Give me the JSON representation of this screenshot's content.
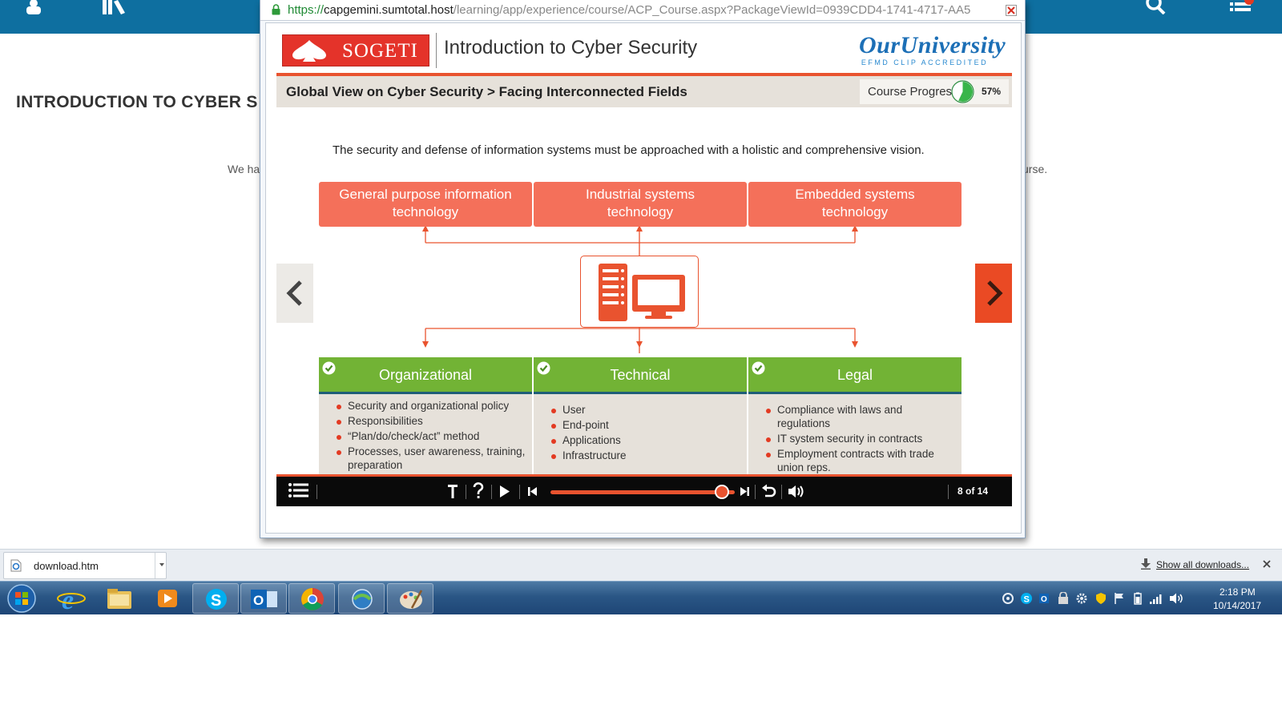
{
  "page": {
    "heading": "INTRODUCTION TO CYBER S",
    "text_left": "We ha",
    "text_right": "urse."
  },
  "browser": {
    "url_scheme": "https://",
    "url_host": "capgemini.sumtotal.host",
    "url_path": "/learning/app/experience/course/ACP_Course.aspx?PackageViewId=0939CDD4-1741-4717-AA5"
  },
  "course": {
    "brand": "SOGETI",
    "title": "Introduction to Cyber Security",
    "partner_name": "OurUniversity",
    "partner_sub": "EFMD CLIP ACCREDITED",
    "breadcrumb": "Global View on Cyber Security > Facing Interconnected Fields",
    "progress_label": "Course Progress",
    "progress_value": 57,
    "progress_text": "57%",
    "lead_text": "The security and defense of information systems must be approached with a holistic and comprehensive vision.",
    "top_boxes": [
      {
        "line1": "General purpose information",
        "line2": "technology"
      },
      {
        "line1": "Industrial systems",
        "line2": "technology"
      },
      {
        "line1": "Embedded systems",
        "line2": "technology"
      }
    ],
    "categories": [
      {
        "title": "Organizational",
        "items": [
          "Security and organizational policy",
          "Responsibilities",
          "“Plan/do/check/act” method",
          "Processes, user awareness, training, preparation"
        ]
      },
      {
        "title": "Technical",
        "items": [
          "User",
          "End-point",
          "Applications",
          "Infrastructure"
        ]
      },
      {
        "title": "Legal",
        "items": [
          "Compliance with laws and regulations",
          "IT system security in contracts",
          "Employment contracts with trade union reps."
        ]
      }
    ],
    "slide_counter": "8 of 14",
    "seek_position": 0.93,
    "colors": {
      "accent": "#e9532f",
      "box": "#f4705a",
      "green": "#72b335",
      "beige": "#e6e1da"
    }
  },
  "downloads": {
    "file_name": "download.htm",
    "show_all": "Show all downloads..."
  },
  "taskbar": {
    "apps": [
      "start",
      "internet-explorer",
      "file-explorer",
      "media-player",
      "skype",
      "outlook",
      "chrome",
      "network-app",
      "paint"
    ],
    "time": "2:18 PM",
    "date": "10/14/2017"
  }
}
